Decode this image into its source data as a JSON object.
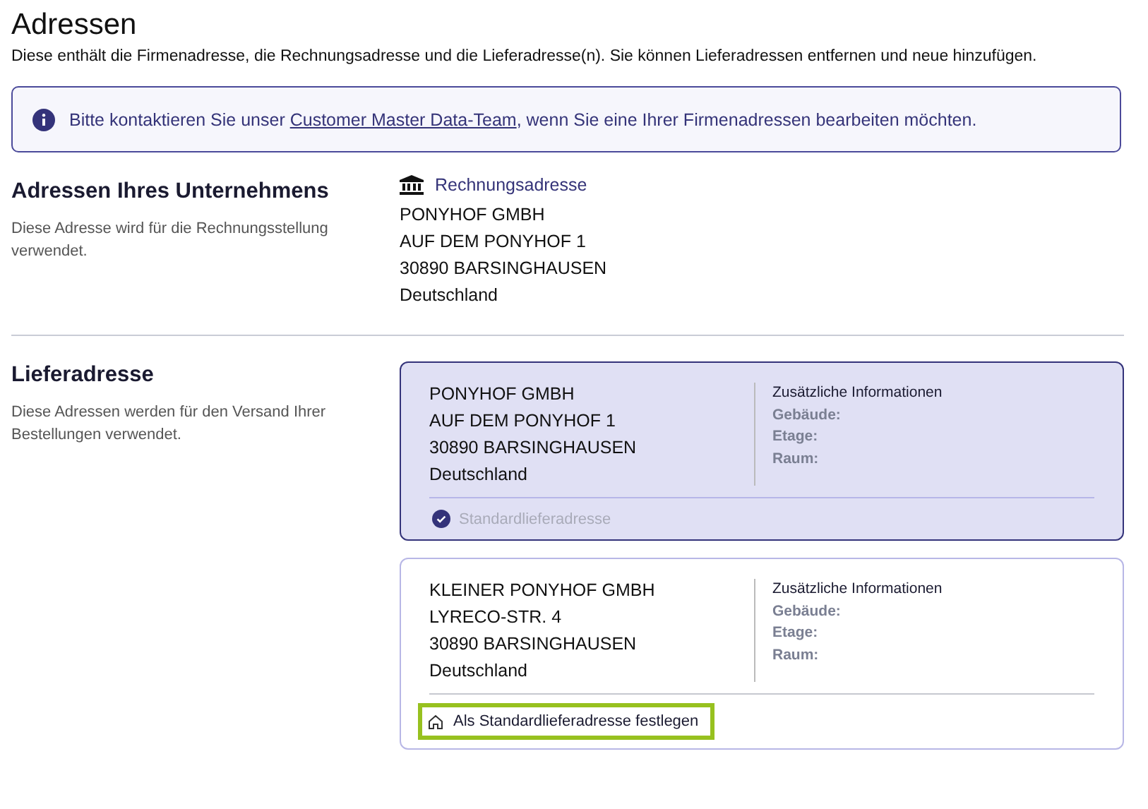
{
  "page": {
    "title": "Adressen",
    "description": "Diese enthält die Firmenadresse, die Rechnungsadresse und die Lieferadresse(n). Sie können Lieferadressen entfernen und neue hinzufügen."
  },
  "notice": {
    "before": "Bitte kontaktieren Sie unser ",
    "link": "Customer Master Data-Team",
    "after": ", wenn Sie eine Ihrer Firmenadressen bearbeiten möchten."
  },
  "company_section": {
    "heading": "Adressen Ihres Unternehmens",
    "description": "Diese Adresse wird für die Rechnungsstellung verwendet.",
    "address_label": "Rechnungsadresse",
    "lines": [
      "PONYHOF GMBH",
      "AUF DEM PONYHOF 1",
      "30890  BARSINGHAUSEN",
      "Deutschland"
    ]
  },
  "delivery_section": {
    "heading": "Lieferadresse",
    "description": "Diese Adressen werden für den Versand Ihrer Bestellungen verwendet.",
    "addresses": [
      {
        "selected": true,
        "lines": [
          "PONYHOF GMBH",
          "AUF DEM PONYHOF 1",
          "30890  BARSINGHAUSEN",
          "Deutschland"
        ],
        "info_heading": "Zusätzliche Informationen",
        "info_labels": [
          "Gebäude:",
          "Etage:",
          "Raum:"
        ],
        "footer": "Standardlieferadresse"
      },
      {
        "selected": false,
        "focused": true,
        "lines": [
          "KLEINER PONYHOF GMBH",
          "LYRECO-STR. 4",
          "30890  BARSINGHAUSEN",
          "Deutschland"
        ],
        "info_heading": "Zusätzliche Informationen",
        "info_labels": [
          "Gebäude:",
          "Etage:",
          "Raum:"
        ],
        "footer": "Als Standardlieferadresse festlegen"
      }
    ]
  }
}
